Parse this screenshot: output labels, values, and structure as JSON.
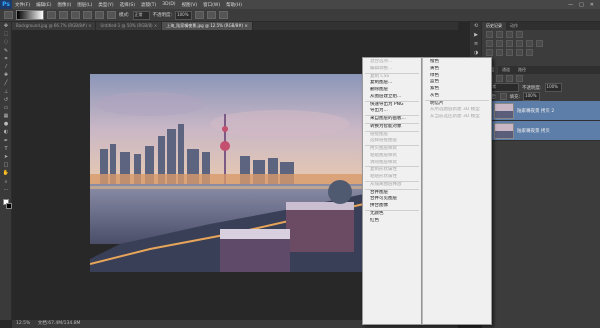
{
  "app": {
    "logo": "Ps"
  },
  "menubar": {
    "items": [
      "文件(F)",
      "编辑(E)",
      "图像(I)",
      "图层(L)",
      "类型(Y)",
      "选择(S)",
      "滤镜(T)",
      "3D(D)",
      "视图(V)",
      "窗口(W)",
      "帮助(H)"
    ],
    "win_min": "—",
    "win_max": "□",
    "win_close": "✕"
  },
  "optionsbar": {
    "mode_label": "模式:",
    "mode_value": "正常",
    "opacity_label": "不透明度:",
    "opacity_value": "100%"
  },
  "tabs": [
    {
      "label": "Background.jpg @ 66.7% (RGB/8#) ×",
      "active": false
    },
    {
      "label": "Untitled-1 @ 50% (RGB/8) ×",
      "active": false
    },
    {
      "label": "上海_陆家嘴夜景.jpg @ 12.5% (RGB/8#) ×",
      "active": true
    }
  ],
  "status": {
    "zoom": "12.5%",
    "doc": "文档:67.4M/134.8M"
  },
  "context_menu": {
    "items": [
      {
        "label": "混合选项...",
        "disabled": true
      },
      {
        "label": "编辑调整...",
        "disabled": true
      },
      {
        "sep": true
      },
      {
        "label": "复制 CSS",
        "disabled": true
      },
      {
        "label": "复制图层...",
        "disabled": false
      },
      {
        "label": "删除图层",
        "disabled": false
      },
      {
        "label": "从图层建立组...",
        "disabled": false
      },
      {
        "sep": true
      },
      {
        "label": "快速导出为 PNG",
        "disabled": false
      },
      {
        "label": "导出为...",
        "disabled": false
      },
      {
        "sep": true
      },
      {
        "label": "来自图层的画板...",
        "disabled": false
      },
      {
        "sep": true
      },
      {
        "label": "转换为智能对象",
        "disabled": false
      },
      {
        "sep": true
      },
      {
        "label": "链接图层",
        "disabled": true
      },
      {
        "label": "选择链接图层",
        "disabled": true
      },
      {
        "sep": true
      },
      {
        "label": "拷贝图层样式",
        "disabled": true
      },
      {
        "label": "粘贴图层样式",
        "disabled": true
      },
      {
        "label": "清除图层样式",
        "disabled": true
      },
      {
        "sep": true
      },
      {
        "label": "复制形状属性",
        "disabled": true
      },
      {
        "label": "粘贴形状属性",
        "disabled": true
      },
      {
        "sep": true
      },
      {
        "label": "从隔离图层释放",
        "disabled": true
      },
      {
        "sep": true
      },
      {
        "label": "合并图层",
        "disabled": false
      },
      {
        "label": "合并可见图层",
        "disabled": false
      },
      {
        "label": "拼合图像",
        "disabled": false
      },
      {
        "sep": true
      },
      {
        "label": "无颜色",
        "disabled": false
      },
      {
        "label": "红色",
        "disabled": false
      }
    ]
  },
  "submenu": {
    "items": [
      {
        "label": "橙色",
        "disabled": false
      },
      {
        "label": "黄色",
        "disabled": false
      },
      {
        "label": "绿色",
        "disabled": false
      },
      {
        "label": "蓝色",
        "disabled": false
      },
      {
        "label": "紫色",
        "disabled": false
      },
      {
        "label": "灰色",
        "disabled": false
      },
      {
        "sep": true
      },
      {
        "label": "明信片",
        "disabled": false
      },
      {
        "label": "从所选图层新建 3D 模型",
        "disabled": true
      },
      {
        "label": "从当前选区新建 3D 模型",
        "disabled": true
      }
    ]
  },
  "right_panel": {
    "tabs": [
      "历史记录",
      "动作"
    ],
    "layer_tabs": [
      "图层",
      "通道",
      "路径"
    ],
    "blend_mode": "正常",
    "opacity_label": "不透明度:",
    "opacity_value": "100%",
    "lock_label": "锁定:",
    "fill_label": "填充:",
    "fill_value": "100%",
    "layers": [
      {
        "name": "陆家嘴夜景 拷贝 2",
        "selected": true
      },
      {
        "name": "陆家嘴夜景 拷贝",
        "selected": true
      }
    ]
  },
  "colors": {
    "accent": "#5d7ea8",
    "menu_bg": "#f0f0f0",
    "ui_dark": "#282828"
  }
}
